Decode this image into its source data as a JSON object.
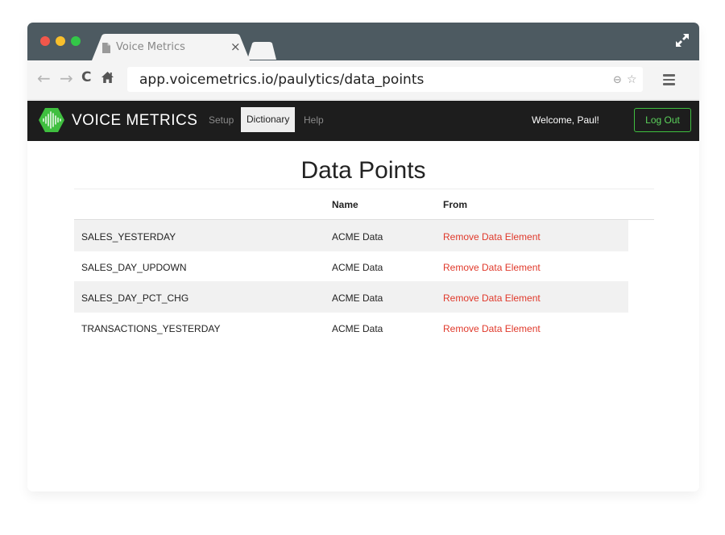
{
  "browser": {
    "tab_title": "Voice Metrics",
    "tab_close": "×",
    "url": "app.voicemetrics.io/paulytics/data_points",
    "nav": {
      "back": "←",
      "forward": "→",
      "reload": "C"
    },
    "url_icons": {
      "zoom": "⊖",
      "star": "☆"
    }
  },
  "app": {
    "brand": "VOICE METRICS",
    "nav": [
      {
        "label": "Setup",
        "active": false
      },
      {
        "label": "Dictionary",
        "active": true
      },
      {
        "label": "Help",
        "active": false
      }
    ],
    "welcome": "Welcome, Paul!",
    "logout_label": "Log Out",
    "colors": {
      "navbar": "#1d1d1d",
      "logo_green": "#3fbf3f",
      "action_red": "#e0392b"
    }
  },
  "page": {
    "title": "Data Points",
    "columns": [
      "",
      "Name",
      "From"
    ],
    "rows": [
      {
        "key": "SALES_YESTERDAY",
        "name": "ACME Data",
        "action": "Remove Data Element"
      },
      {
        "key": "SALES_DAY_UPDOWN",
        "name": "ACME Data",
        "action": "Remove Data Element"
      },
      {
        "key": "SALES_DAY_PCT_CHG",
        "name": "ACME Data",
        "action": "Remove Data Element"
      },
      {
        "key": "TRANSACTIONS_YESTERDAY",
        "name": "ACME Data",
        "action": "Remove Data Element"
      }
    ]
  },
  "icons": {
    "window_close": "red-dot-icon",
    "window_minimize": "yellow-dot-icon",
    "window_maximize": "green-dot-icon",
    "tab_page": "document-icon",
    "home": "home-icon",
    "menu": "hamburger-icon",
    "fullscreen": "expand-arrows-icon",
    "logo": "waveform-icon"
  }
}
